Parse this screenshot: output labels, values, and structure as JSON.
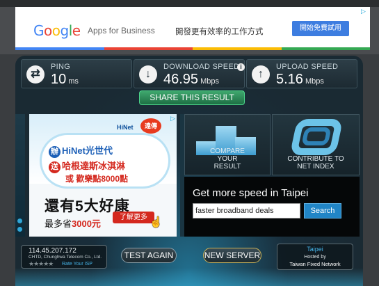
{
  "google_ad": {
    "logo": "Google",
    "product": "Apps for Business",
    "tagline": "開發更有效率的工作方式",
    "cta": "開始免費試用",
    "colors": [
      "#4285f4",
      "#ea4335",
      "#fbbc05",
      "#34a853"
    ]
  },
  "metrics": [
    {
      "label": "PING",
      "value": "10",
      "unit": "ms",
      "icon": "ping-icon",
      "glyph": "⇄"
    },
    {
      "label": "DOWNLOAD SPEED",
      "value": "46.95",
      "unit": "Mbps",
      "icon": "download-icon",
      "glyph": "↓"
    },
    {
      "label": "UPLOAD SPEED",
      "value": "5.16",
      "unit": "Mbps",
      "icon": "upload-icon",
      "glyph": "↑"
    }
  ],
  "share_label": "SHARE THIS RESULT",
  "hinet_ad": {
    "brand": "HiNet",
    "partner": "遠傳",
    "line1_tag": "辦",
    "line1": "HiNet光世代",
    "line2_tag": "送",
    "line2": "哈根達斯冰淇淋",
    "line3": "或 歡樂點8000點",
    "headline": "還有5大好康",
    "save_prefix": "最多省",
    "save_amount": "3000元",
    "more": "了解更多"
  },
  "tiles": {
    "compare": "COMPARE YOUR RESULT",
    "contribute": "CONTRIBUTE TO NET INDEX"
  },
  "speed_box": {
    "title": "Get more speed in Taipei",
    "query": "faster broadband deals",
    "button": "Search"
  },
  "isp": {
    "ip": "114.45.207.172",
    "org": "CHTD, Chunghwa Telecom Co., Ltd.",
    "stars": "★★★★★",
    "rate": "Rate Your ISP"
  },
  "buttons": {
    "test_again": "TEST AGAIN",
    "new_server": "NEW SERVER"
  },
  "server": {
    "city": "Taipei",
    "hosted": "Hosted by",
    "network": "Taiwan Fixed Network"
  }
}
